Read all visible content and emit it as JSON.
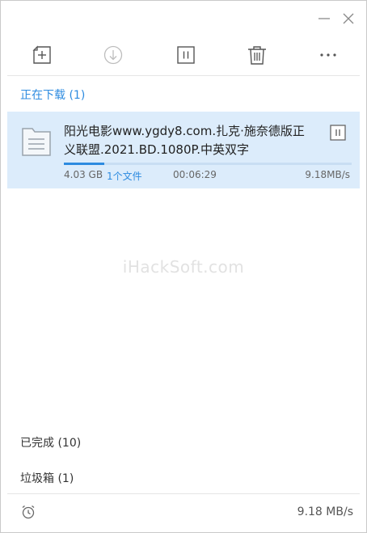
{
  "window": {
    "minimize_icon": "minimize-icon",
    "close_icon": "close-icon"
  },
  "toolbar": {
    "icons": [
      "new-task-icon",
      "start-icon",
      "pause-icon",
      "delete-icon",
      "more-icon"
    ]
  },
  "downloading": {
    "label": "正在下载 (1)"
  },
  "task": {
    "name": "阳光电影www.ygdy8.com.扎克·施奈德版正义联盟.2021.BD.1080P.中英双字",
    "size": "4.03 GB",
    "files": "1个文件",
    "elapsed": "00:06:29",
    "speed": "9.18MB/s",
    "progress_fraction": 0.14
  },
  "watermark": "iHackSoft.com",
  "completed": {
    "label": "已完成 (10)"
  },
  "trash": {
    "label": "垃圾箱 (1)"
  },
  "status": {
    "total_speed": "9.18 MB/s"
  },
  "colors": {
    "accent": "#2d8be0",
    "selected_row": "#dcecfb"
  }
}
